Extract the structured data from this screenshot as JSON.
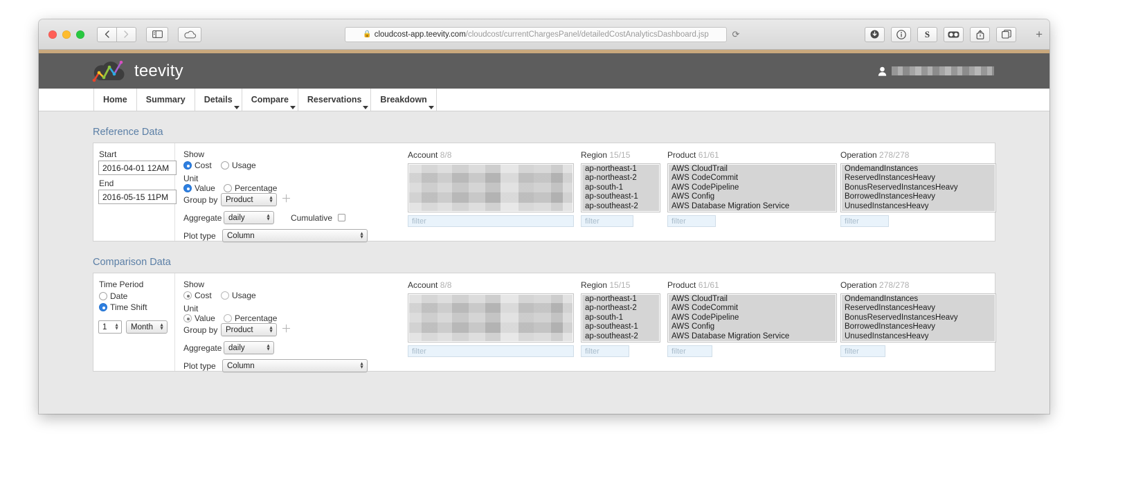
{
  "browser": {
    "url_prefix": "cloudcost-app.teevity.com",
    "url_suffix": "/cloudcost/currentChargesPanel/detailedCostAnalyticsDashboard.jsp",
    "lock_icon": "lock-icon",
    "reload_icon": "reload-icon",
    "back_icon": "back-chevron-icon",
    "forward_icon": "forward-chevron-icon",
    "sidebar_icon": "sidebar-icon",
    "cloud_icon": "icloud-icon",
    "toolbar_right": [
      {
        "name": "downloads-icon",
        "glyph": "⬇"
      },
      {
        "name": "info-icon",
        "glyph": "ⓘ"
      },
      {
        "name": "s-extension-icon",
        "glyph": "S"
      },
      {
        "name": "reader-icon",
        "glyph": "◐◑"
      },
      {
        "name": "share-icon",
        "glyph": "↑"
      },
      {
        "name": "tabs-overview-icon",
        "glyph": "⧉"
      }
    ],
    "new_tab_label": "+"
  },
  "app": {
    "brand": "teevity",
    "logo_icon": "teevity-cloud-chart-logo",
    "user_icon": "user-avatar-icon",
    "username_redacted": true,
    "nav_tabs": [
      {
        "label": "Home",
        "has_caret": false
      },
      {
        "label": "Summary",
        "has_caret": false
      },
      {
        "label": "Details",
        "has_caret": true
      },
      {
        "label": "Compare",
        "has_caret": true
      },
      {
        "label": "Reservations",
        "has_caret": true
      },
      {
        "label": "Breakdown",
        "has_caret": true
      }
    ]
  },
  "reference": {
    "section_title": "Reference Data",
    "start_label": "Start",
    "start_value": "2016-04-01 12AM",
    "end_label": "End",
    "end_value": "2016-05-15 11PM",
    "show_label": "Show",
    "show_cost": "Cost",
    "show_usage": "Usage",
    "show_selected": "Cost",
    "unit_label": "Unit",
    "unit_value": "Value",
    "unit_percentage": "Percentage",
    "unit_selected": "Value",
    "groupby_label": "Group by",
    "groupby_value": "Product",
    "add_groupby_icon": "plus-icon",
    "aggregate_label": "Aggregate",
    "aggregate_value": "daily",
    "cumulative_label": "Cumulative",
    "cumulative_checked": false,
    "plottype_label": "Plot type",
    "plottype_value": "Column",
    "selectors": [
      {
        "title": "Account",
        "count": "8/8",
        "redacted": true,
        "items": [],
        "filter_placeholder": "filter"
      },
      {
        "title": "Region",
        "count": "15/15",
        "redacted": false,
        "items": [
          "ap-northeast-1",
          "ap-northeast-2",
          "ap-south-1",
          "ap-southeast-1",
          "ap-southeast-2"
        ],
        "filter_placeholder": "filter"
      },
      {
        "title": "Product",
        "count": "61/61",
        "redacted": false,
        "items": [
          "AWS CloudTrail",
          "AWS CodeCommit",
          "AWS CodePipeline",
          "AWS Config",
          "AWS Database Migration Service"
        ],
        "filter_placeholder": "filter"
      },
      {
        "title": "Operation",
        "count": "278/278",
        "redacted": false,
        "items": [
          "OndemandInstances",
          "ReservedInstancesHeavy",
          "BonusReservedInstancesHeavy",
          "BorrowedInstancesHeavy",
          "UnusedInstancesHeavy"
        ],
        "filter_placeholder": "filter"
      }
    ]
  },
  "comparison": {
    "section_title": "Comparison Data",
    "timeperiod_label": "Time Period",
    "date_label": "Date",
    "timeshift_label": "Time Shift",
    "timeperiod_selected": "Time Shift",
    "shift_amount": "1",
    "shift_unit": "Month",
    "show_label": "Show",
    "show_cost": "Cost",
    "show_usage": "Usage",
    "show_selected": "Cost",
    "unit_label": "Unit",
    "unit_value": "Value",
    "unit_percentage": "Percentage",
    "unit_selected": "Value",
    "groupby_label": "Group by",
    "groupby_value": "Product",
    "add_groupby_icon": "plus-icon",
    "aggregate_label": "Aggregate",
    "aggregate_value": "daily",
    "plottype_label": "Plot type",
    "plottype_value": "Column",
    "selectors": [
      {
        "title": "Account",
        "count": "8/8",
        "redacted": true,
        "items": [],
        "filter_placeholder": "filter"
      },
      {
        "title": "Region",
        "count": "15/15",
        "redacted": false,
        "items": [
          "ap-northeast-1",
          "ap-northeast-2",
          "ap-south-1",
          "ap-southeast-1",
          "ap-southeast-2"
        ],
        "filter_placeholder": "filter"
      },
      {
        "title": "Product",
        "count": "61/61",
        "redacted": false,
        "items": [
          "AWS CloudTrail",
          "AWS CodeCommit",
          "AWS CodePipeline",
          "AWS Config",
          "AWS Database Migration Service"
        ],
        "filter_placeholder": "filter"
      },
      {
        "title": "Operation",
        "count": "278/278",
        "redacted": false,
        "items": [
          "OndemandInstances",
          "ReservedInstancesHeavy",
          "BonusReservedInstancesHeavy",
          "BorrowedInstancesHeavy",
          "UnusedInstancesHeavy"
        ],
        "filter_placeholder": "filter"
      }
    ]
  },
  "colors": {
    "accent_blue": "#2e7fe0",
    "section_heading": "#5b7fa6",
    "header_gray": "#5d5d5d",
    "gold_bar": "#c9a87c",
    "page_bg": "#e8e8e8"
  }
}
